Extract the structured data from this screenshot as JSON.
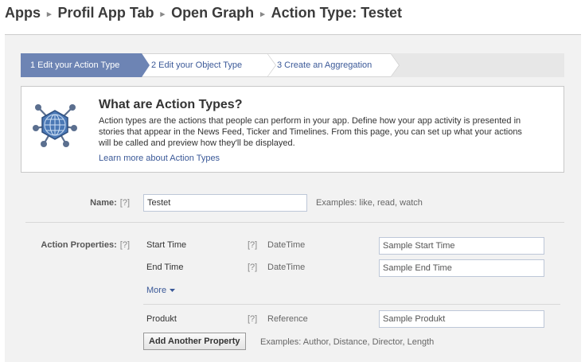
{
  "breadcrumb": {
    "items": [
      "Apps",
      "Profil App Tab",
      "Open Graph",
      "Action Type: Testet"
    ],
    "separator": "▸"
  },
  "steps": [
    {
      "label": "1 Edit your Action Type",
      "active": true
    },
    {
      "label": "2 Edit your Object Type",
      "active": false
    },
    {
      "label": "3 Create an Aggregation",
      "active": false
    }
  ],
  "info": {
    "icon": "globe-graph-icon",
    "title": "What are Action Types?",
    "text": "Action types are the actions that people can perform in your app. Define how your app activity is presented in stories that appear in the News Feed, Ticker and Timelines. From this page, you can set up what your actions will be called and preview how they'll be displayed.",
    "link": "Learn more about Action Types"
  },
  "name_field": {
    "label": "Name:",
    "help": "[?]",
    "value": "Testet",
    "hint": "Examples: like, read, watch"
  },
  "action_properties": {
    "label": "Action Properties:",
    "help": "[?]",
    "properties": [
      {
        "name": "Start Time",
        "help": "[?]",
        "type": "DateTime",
        "placeholder": "Sample Start Time"
      },
      {
        "name": "End Time",
        "help": "[?]",
        "type": "DateTime",
        "placeholder": "Sample End Time"
      }
    ],
    "more": "More",
    "custom_properties": [
      {
        "name": "Produkt",
        "help": "[?]",
        "type": "Reference",
        "placeholder": "Sample Produkt"
      }
    ],
    "add_button": "Add Another Property",
    "add_hint": "Examples: Author, Distance, Director, Length"
  },
  "colors": {
    "link": "#3b5998",
    "active_step": "#6d84b4",
    "panel_bg": "#f2f2f2"
  }
}
